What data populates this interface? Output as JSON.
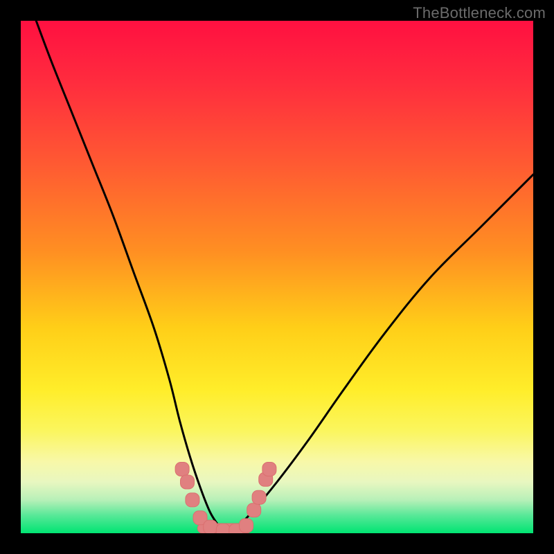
{
  "watermark": "TheBottleneck.com",
  "colors": {
    "frame": "#000000",
    "curve_stroke": "#000000",
    "marker_fill": "#e08080",
    "marker_stroke": "#da6f6f",
    "gradient_stops": [
      {
        "offset": 0.0,
        "color": "#ff1041"
      },
      {
        "offset": 0.12,
        "color": "#ff2c3e"
      },
      {
        "offset": 0.28,
        "color": "#ff5a32"
      },
      {
        "offset": 0.45,
        "color": "#ff8f22"
      },
      {
        "offset": 0.6,
        "color": "#ffcf18"
      },
      {
        "offset": 0.72,
        "color": "#ffed2a"
      },
      {
        "offset": 0.8,
        "color": "#fbf65e"
      },
      {
        "offset": 0.86,
        "color": "#f8f8a8"
      },
      {
        "offset": 0.9,
        "color": "#e8f7c0"
      },
      {
        "offset": 0.935,
        "color": "#b8f0b8"
      },
      {
        "offset": 0.965,
        "color": "#58e898"
      },
      {
        "offset": 1.0,
        "color": "#00e472"
      }
    ]
  },
  "chart_data": {
    "type": "line",
    "title": "",
    "xlabel": "",
    "ylabel": "",
    "xlim": [
      0,
      100
    ],
    "ylim": [
      0,
      100
    ],
    "series": [
      {
        "name": "left-curve",
        "x": [
          3,
          6,
          10,
          14,
          18,
          22,
          26,
          29,
          31,
          33,
          35,
          37,
          39,
          40
        ],
        "y": [
          100,
          92,
          82,
          72,
          62,
          51,
          40,
          30,
          22,
          15,
          9,
          4,
          1,
          0
        ]
      },
      {
        "name": "right-curve",
        "x": [
          40,
          42,
          45,
          50,
          56,
          63,
          71,
          80,
          90,
          100
        ],
        "y": [
          0,
          1,
          4,
          10,
          18,
          28,
          39,
          50,
          60,
          70
        ]
      },
      {
        "name": "valley-floor",
        "x": [
          33,
          45
        ],
        "y": [
          0,
          0
        ]
      }
    ],
    "markers": [
      {
        "x": 31.5,
        "y": 12.5
      },
      {
        "x": 32.5,
        "y": 10.0
      },
      {
        "x": 33.5,
        "y": 6.5
      },
      {
        "x": 35.0,
        "y": 3.0
      },
      {
        "x": 37.0,
        "y": 1.2
      },
      {
        "x": 39.5,
        "y": 0.5
      },
      {
        "x": 42.0,
        "y": 0.5
      },
      {
        "x": 44.0,
        "y": 1.5
      },
      {
        "x": 45.5,
        "y": 4.5
      },
      {
        "x": 46.5,
        "y": 7.0
      },
      {
        "x": 47.8,
        "y": 10.5
      },
      {
        "x": 48.5,
        "y": 12.5
      }
    ]
  }
}
